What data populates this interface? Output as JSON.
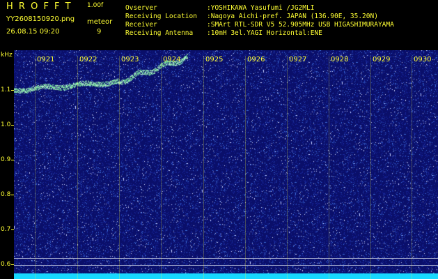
{
  "header": {
    "title": "H R O F F T",
    "version": "1.00f",
    "filename": "YY2608150920.png",
    "datetime": "26.08.15 09:20",
    "meteor_label": "meteor",
    "meteor_count": "9",
    "info": [
      {
        "label": "Ovserver",
        "value": ":YOSHIKAWA Yasufumi /JG2MLI"
      },
      {
        "label": "Receiving Location",
        "value": ":Nagoya Aichi-pref. JAPAN (136.90E, 35.20N)"
      },
      {
        "label": "Receiver",
        "value": ":SMArt RTL-SDR V5 52.905MHz USB HIGASHIMURAYAMA"
      },
      {
        "label": "Receiving Antenna",
        "value": ":10mH 3el.YAGI Horizontal:ENE"
      }
    ]
  },
  "spectrogram": {
    "y_unit": "kHz",
    "y_ticks": [
      "1.1",
      "1.0",
      "0.9",
      "0.8",
      "0.7",
      "0.6"
    ],
    "time_labels": [
      "0921",
      "0922",
      "0923",
      "0924",
      "0925",
      "0926",
      "0927",
      "0928",
      "0929",
      "0930"
    ]
  },
  "colors": {
    "background": "#0a0f6a",
    "text": "#ffff33",
    "baseline": "#17d8ff",
    "trace": "#7dff9a"
  }
}
